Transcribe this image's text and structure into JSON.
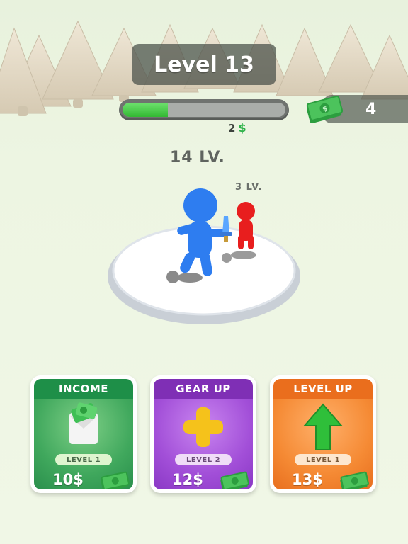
{
  "hud": {
    "level_label": "Level 13",
    "progress_fraction": 0.28,
    "reward_amount": "2",
    "reward_currency": "$",
    "money_count": "4"
  },
  "arena": {
    "player_level": "14 LV.",
    "enemy_level": "3 LV."
  },
  "cards": {
    "income": {
      "title": "INCOME",
      "level": "LEVEL 1",
      "price": "10$"
    },
    "gear_up": {
      "title": "GEAR UP",
      "level": "LEVEL 2",
      "price": "12$"
    },
    "level_up": {
      "title": "LEVEL UP",
      "level": "LEVEL 1",
      "price": "13$"
    }
  },
  "colors": {
    "player": "#2e7df0",
    "enemy": "#e81e1e",
    "income_accent": "#1e8f48",
    "gear_accent": "#7f2fb5",
    "levelup_accent": "#ea6e1d"
  },
  "icons": {
    "money": "cash-stack-icon",
    "income_card": "money-envelope-icon",
    "gear_card": "plus-icon",
    "levelup_card": "up-arrow-icon"
  }
}
